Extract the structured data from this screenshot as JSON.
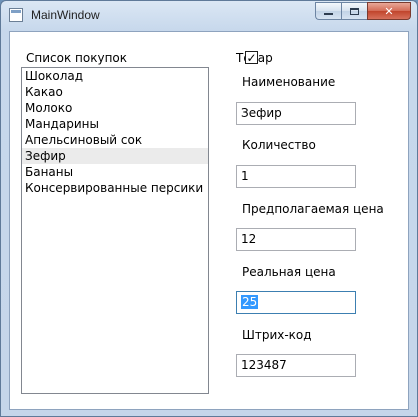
{
  "window": {
    "title": "MainWindow"
  },
  "shopping_list": {
    "label": "Список покупок",
    "items": [
      "Шоколад",
      "Какао",
      "Молоко",
      "Мандарины",
      "Апельсиновый сок",
      "Зефир",
      "Бананы",
      "Консервированные персики"
    ],
    "selected_index": 5
  },
  "product": {
    "checkbox_label": "Товар",
    "checked": true,
    "name_label": "Наименование",
    "name_value": "Зефир",
    "quantity_label": "Количество",
    "quantity_value": "1",
    "expected_price_label": "Предполагаемая цена",
    "expected_price_value": "12",
    "real_price_label": "Реальная цена",
    "real_price_value": "25",
    "barcode_label": "Штрих-код",
    "barcode_value": "123487"
  }
}
